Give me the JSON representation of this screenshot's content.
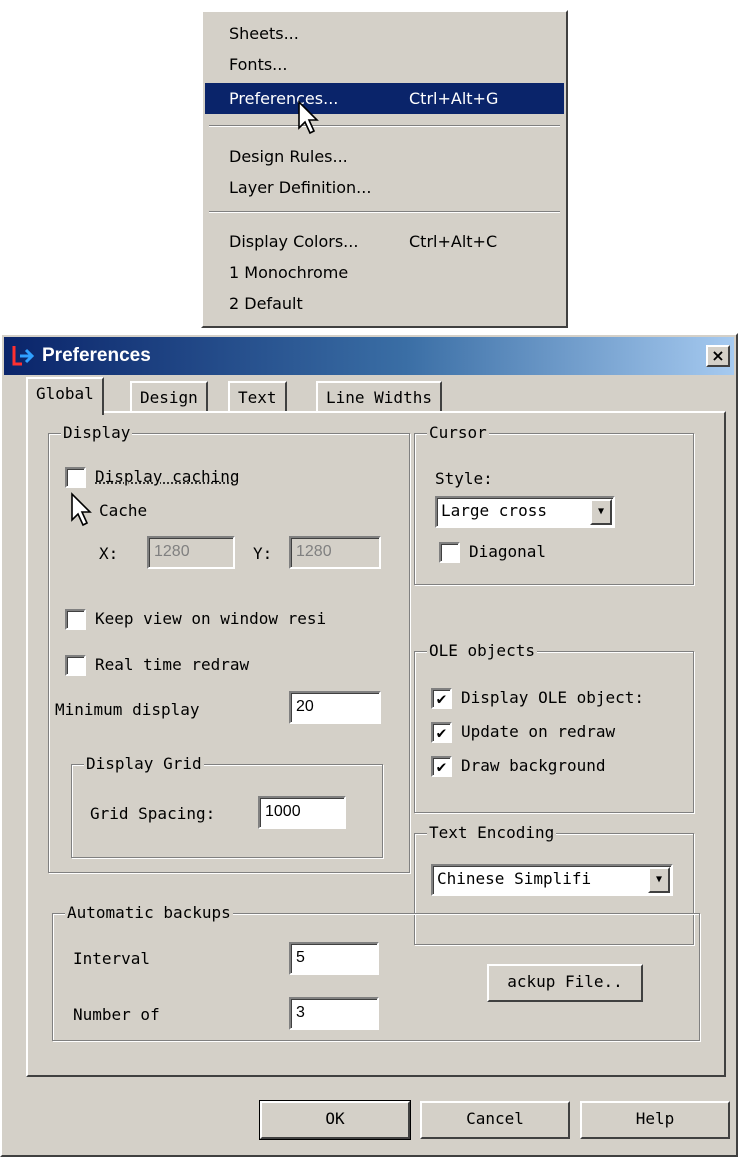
{
  "menu": {
    "items": [
      {
        "label": "Sheets...",
        "shortcut": ""
      },
      {
        "label": "Fonts...",
        "shortcut": ""
      },
      {
        "label": "Preferences...",
        "shortcut": "Ctrl+Alt+G"
      },
      {
        "label": "Design Rules...",
        "shortcut": ""
      },
      {
        "label": "Layer Definition...",
        "shortcut": ""
      },
      {
        "label": "Display Colors...",
        "shortcut": "Ctrl+Alt+C"
      },
      {
        "label": "1 Monochrome",
        "shortcut": ""
      },
      {
        "label": "2 Default",
        "shortcut": ""
      }
    ],
    "highlight_color": "#0a246a"
  },
  "dialog": {
    "title": "Preferences",
    "close_label": "×",
    "tabs": [
      "Global",
      "Design",
      "Text",
      "Line Widths"
    ],
    "display": {
      "label": "Display",
      "display_caching": "Display caching",
      "cache_label": "Cache",
      "x_label": "X:",
      "x_value": "1280",
      "y_label": "Y:",
      "y_value": "1280",
      "keep_view": "Keep view on window resi",
      "real_time_redraw": "Real time redraw",
      "minimum_display_label": "Minimum display",
      "minimum_display_value": "20",
      "grid": {
        "label": "Display Grid",
        "spacing_label": "Grid Spacing:",
        "spacing_value": "1000"
      }
    },
    "cursor": {
      "label": "Cursor",
      "style_label": "Style:",
      "style_value": "Large cross",
      "diagonal": "Diagonal"
    },
    "ole": {
      "label": "OLE objects",
      "display_ole": "Display OLE object:",
      "update_on_redraw": "Update on redraw",
      "draw_background": "Draw background"
    },
    "encoding": {
      "label": "Text Encoding",
      "value": "Chinese Simplifi"
    },
    "backups": {
      "label": "Automatic backups",
      "interval_label": "Interval",
      "interval_value": "5",
      "number_label": "Number of",
      "number_value": "3",
      "backup_file_button": "ackup File.."
    },
    "buttons": {
      "ok": "OK",
      "cancel": "Cancel",
      "help": "Help"
    },
    "check_mark": "✔"
  }
}
